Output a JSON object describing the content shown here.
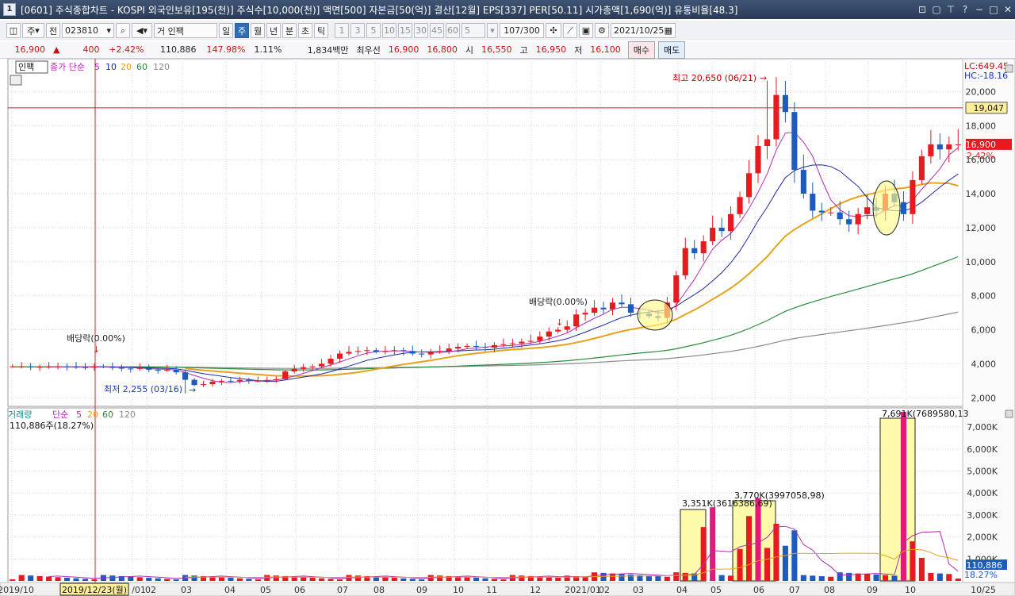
{
  "window": {
    "title": "[0601] 주식종합차트 - KOSPI 외국인보유[195(천)] 주식수[10,000(천)] 액면[500] 자본금[50(억)] 결산[12월] EPS[337] PER[50.11] 시가총액[1,690(억)] 유통비율[48.3]",
    "icon_label": "1"
  },
  "toolbar": {
    "market_label": "주",
    "market_type": "전",
    "code": "023810",
    "search_mode": "거",
    "stock_name": "인팩",
    "period_tabs": [
      "일",
      "주",
      "월",
      "년",
      "분",
      "초",
      "틱"
    ],
    "active_period": "주",
    "interval_options": [
      "1",
      "3",
      "5",
      "10",
      "15",
      "30",
      "45",
      "60"
    ],
    "custom_interval": "5",
    "count": "107/300",
    "date": "2021/10/25"
  },
  "quote": {
    "price": "16,900",
    "arrow": "▲",
    "change": "400",
    "change_pct": "+2.42%",
    "volume": "110,886",
    "volume_ratio": "147.98%",
    "turnover": "1.11%",
    "trade_value": "1,834백만",
    "best_bid_label": "최우선",
    "best_bid": "16,900",
    "best_ask": "16,800",
    "open_label": "시",
    "open": "16,550",
    "high_label": "고",
    "high": "16,950",
    "low_label": "저",
    "low": "16,100",
    "buy_label": "매수",
    "sell_label": "매도"
  },
  "price_panel": {
    "stock_tag": "인팩",
    "legend_title": "종가 단순",
    "ma_periods": [
      "5",
      "10",
      "20",
      "60",
      "120"
    ],
    "lc": "LC:649.45",
    "hc": "HC:-18.16",
    "y_ticks": [
      "20,000",
      "18,000",
      "16,000",
      "14,000",
      "12,000",
      "10,000",
      "8,000",
      "6,000",
      "4,000",
      "2,000"
    ],
    "crosshair_value": "19,047",
    "last_price": "16,900",
    "last_pct": "2.42%",
    "high_annotation": "최고 20,650 (06/21)",
    "low_annotation": "최저 2,255 (03/16)",
    "dividend_1": "배당락(0.00%)",
    "dividend_2": "배당락(0.00%)"
  },
  "volume_panel": {
    "legend_title": "거래량",
    "legend_ma": "단순",
    "ma_periods": [
      "5",
      "20",
      "60",
      "120"
    ],
    "current": "110,886주(18.27%)",
    "y_ticks": [
      "7,000K",
      "6,000K",
      "5,000K",
      "4,000K",
      "3,000K",
      "2,000K",
      "1,000K"
    ],
    "last_value": "110,886",
    "last_pct": "18.27%",
    "peak_labels": [
      "3,351K(3616386,69)",
      "3,770K(3997058,98)",
      "7,691K(7689580,13"
    ]
  },
  "x_axis": {
    "labels": [
      "2019/10",
      "2019/12/23(월)",
      "/01",
      "02",
      "03",
      "04",
      "05",
      "06",
      "07",
      "08",
      "09",
      "10",
      "11",
      "12",
      "2021/01",
      "02",
      "03",
      "04",
      "05",
      "06",
      "07",
      "08",
      "09",
      "10",
      "10/25"
    ]
  },
  "colors": {
    "up": "#e8191f",
    "down": "#1e5bbf",
    "ma5": "#b02cb0",
    "ma10": "#1a2aa6",
    "ma20": "#e8a21a",
    "ma60": "#2a8c3a",
    "ma120": "#8a8a8a",
    "grid": "#d6d6d6",
    "axis_bg": "#f0f0f0"
  },
  "chart_data": {
    "type": "candlestick",
    "interval": "weekly",
    "price_ylim": [
      1500,
      21000
    ],
    "volume_ylim": [
      0,
      7800000
    ],
    "candles": [],
    "volume": [],
    "ma5": [],
    "ma10": [],
    "ma20": [],
    "ma60": [],
    "ma120": []
  }
}
